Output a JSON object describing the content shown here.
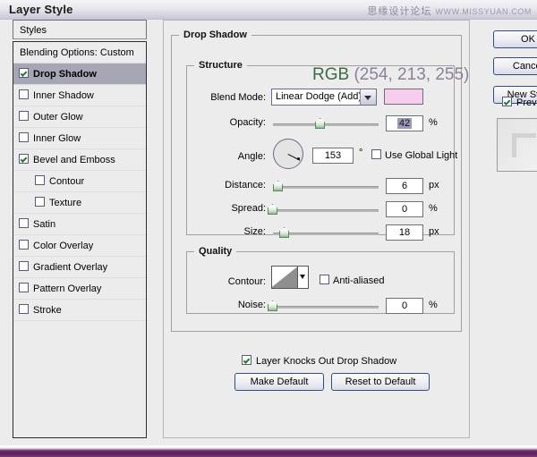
{
  "window": {
    "title": "Layer Style",
    "watermark_cn": "思缘设计论坛",
    "watermark_url": "WWW.MISSYUAN.COM"
  },
  "styles_panel": {
    "header": "Styles",
    "items": [
      {
        "label": "Blending Options: Custom",
        "checkbox": false,
        "checked": false,
        "selected": false,
        "sub": false
      },
      {
        "label": "Drop Shadow",
        "checkbox": true,
        "checked": true,
        "selected": true,
        "sub": false
      },
      {
        "label": "Inner Shadow",
        "checkbox": true,
        "checked": false,
        "selected": false,
        "sub": false
      },
      {
        "label": "Outer Glow",
        "checkbox": true,
        "checked": false,
        "selected": false,
        "sub": false
      },
      {
        "label": "Inner Glow",
        "checkbox": true,
        "checked": false,
        "selected": false,
        "sub": false
      },
      {
        "label": "Bevel and Emboss",
        "checkbox": true,
        "checked": true,
        "selected": false,
        "sub": false
      },
      {
        "label": "Contour",
        "checkbox": true,
        "checked": false,
        "selected": false,
        "sub": true
      },
      {
        "label": "Texture",
        "checkbox": true,
        "checked": false,
        "selected": false,
        "sub": true
      },
      {
        "label": "Satin",
        "checkbox": true,
        "checked": false,
        "selected": false,
        "sub": false
      },
      {
        "label": "Color Overlay",
        "checkbox": true,
        "checked": false,
        "selected": false,
        "sub": false
      },
      {
        "label": "Gradient Overlay",
        "checkbox": true,
        "checked": false,
        "selected": false,
        "sub": false
      },
      {
        "label": "Pattern Overlay",
        "checkbox": true,
        "checked": false,
        "selected": false,
        "sub": false
      },
      {
        "label": "Stroke",
        "checkbox": true,
        "checked": false,
        "selected": false,
        "sub": false
      }
    ]
  },
  "drop_shadow": {
    "group_title": "Drop Shadow",
    "structure": {
      "title": "Structure",
      "annotation": {
        "prefix": "RGB",
        "value": "(254, 213, 255)",
        "prefix_color": "#3e6b46",
        "value_color": "#8d7f9a"
      },
      "blend_mode": {
        "label": "Blend Mode:",
        "value": "Linear Dodge (Add)"
      },
      "color_swatch": "#f6cdee",
      "opacity": {
        "label": "Opacity:",
        "value": "42",
        "unit": "%",
        "slider_pct": 42
      },
      "angle": {
        "label": "Angle:",
        "value": "153",
        "unit": "°",
        "dial_degrees": 153
      },
      "use_global_light": {
        "label": "Use Global Light",
        "checked": false
      },
      "distance": {
        "label": "Distance:",
        "value": "6",
        "unit": "px",
        "slider_pct": 4
      },
      "spread": {
        "label": "Spread:",
        "value": "0",
        "unit": "%",
        "slider_pct": 0
      },
      "size": {
        "label": "Size:",
        "value": "18",
        "unit": "px",
        "slider_pct": 11
      }
    },
    "quality": {
      "title": "Quality",
      "contour": {
        "label": "Contour:"
      },
      "anti_aliased": {
        "label": "Anti-aliased",
        "checked": false
      },
      "noise": {
        "label": "Noise:",
        "value": "0",
        "unit": "%",
        "slider_pct": 0
      }
    },
    "knockout": {
      "label": "Layer Knocks Out Drop Shadow",
      "checked": true
    },
    "make_default": "Make Default",
    "reset_default": "Reset to Default"
  },
  "right_panel": {
    "ok": "OK",
    "cancel": "Cancel",
    "new_style": "New Style...",
    "preview": {
      "label": "Preview",
      "checked": true
    }
  }
}
